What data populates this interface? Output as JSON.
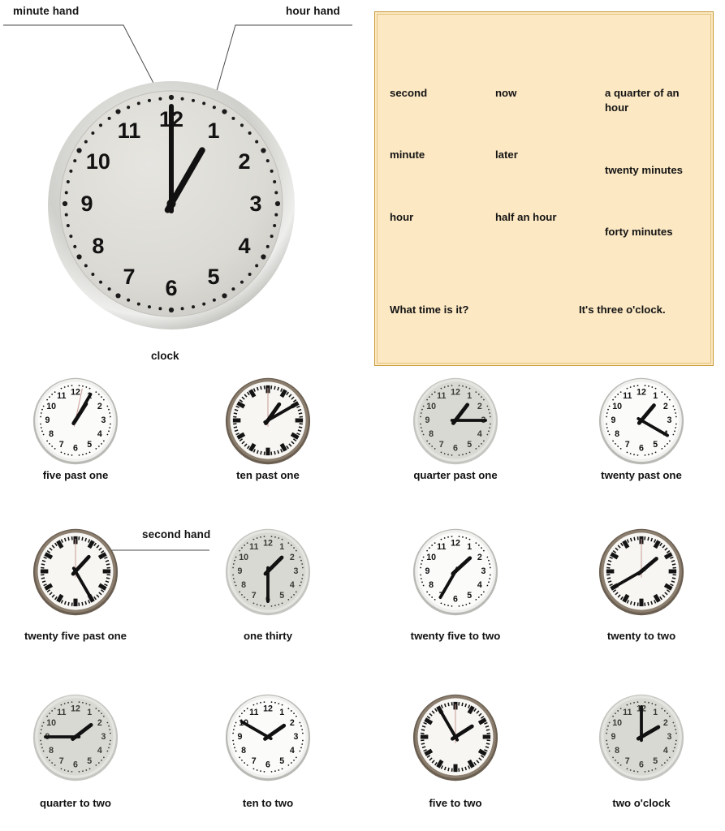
{
  "annotations": {
    "minute_hand": "minute hand",
    "hour_hand": "hour hand",
    "second_hand": "second hand"
  },
  "main_clock": {
    "caption": "clock",
    "hour": 1,
    "minute": 0,
    "face_color": "#dcdbd5",
    "rim_color": "#c9c9c6"
  },
  "vocabulary": {
    "box_bg": "#fce8c3",
    "box_border": "#c79a37",
    "col1": [
      "second",
      "minute",
      "hour"
    ],
    "col2": [
      "now",
      "later",
      "half an hour"
    ],
    "col3": [
      "a quarter of an hour",
      "twenty minutes",
      "forty minutes"
    ],
    "question": "What time is it?",
    "answer": "It's three o'clock."
  },
  "clock_grid": {
    "rows": [
      [
        {
          "label": "five past one",
          "hour": 1,
          "minute": 5,
          "style": "silver-numerals",
          "second": 2
        },
        {
          "label": "ten past one",
          "hour": 1,
          "minute": 10,
          "style": "dark-batons",
          "second": 0
        },
        {
          "label": "quarter past one",
          "hour": 1,
          "minute": 15,
          "style": "grey-plain",
          "second": null
        },
        {
          "label": "twenty past one",
          "hour": 1,
          "minute": 20,
          "style": "silver-numerals",
          "second": null
        }
      ],
      [
        {
          "label": "twenty five past one",
          "hour": 1,
          "minute": 25,
          "style": "dark-batons",
          "second": 0
        },
        {
          "label": "one thirty",
          "hour": 1,
          "minute": 30,
          "style": "grey-plain",
          "second": null
        },
        {
          "label": "twenty five to two",
          "hour": 1,
          "minute": 35,
          "style": "silver-numerals",
          "second": null
        },
        {
          "label": "twenty to two",
          "hour": 1,
          "minute": 40,
          "style": "dark-batons",
          "second": 0
        }
      ],
      [
        {
          "label": "quarter to two",
          "hour": 1,
          "minute": 45,
          "style": "grey-plain",
          "second": null
        },
        {
          "label": "ten to two",
          "hour": 1,
          "minute": 50,
          "style": "silver-numerals",
          "second": null
        },
        {
          "label": "five to two",
          "hour": 1,
          "minute": 55,
          "style": "dark-batons",
          "second": 0
        },
        {
          "label": "two o'clock",
          "hour": 2,
          "minute": 0,
          "style": "grey-plain",
          "second": null
        }
      ]
    ]
  }
}
